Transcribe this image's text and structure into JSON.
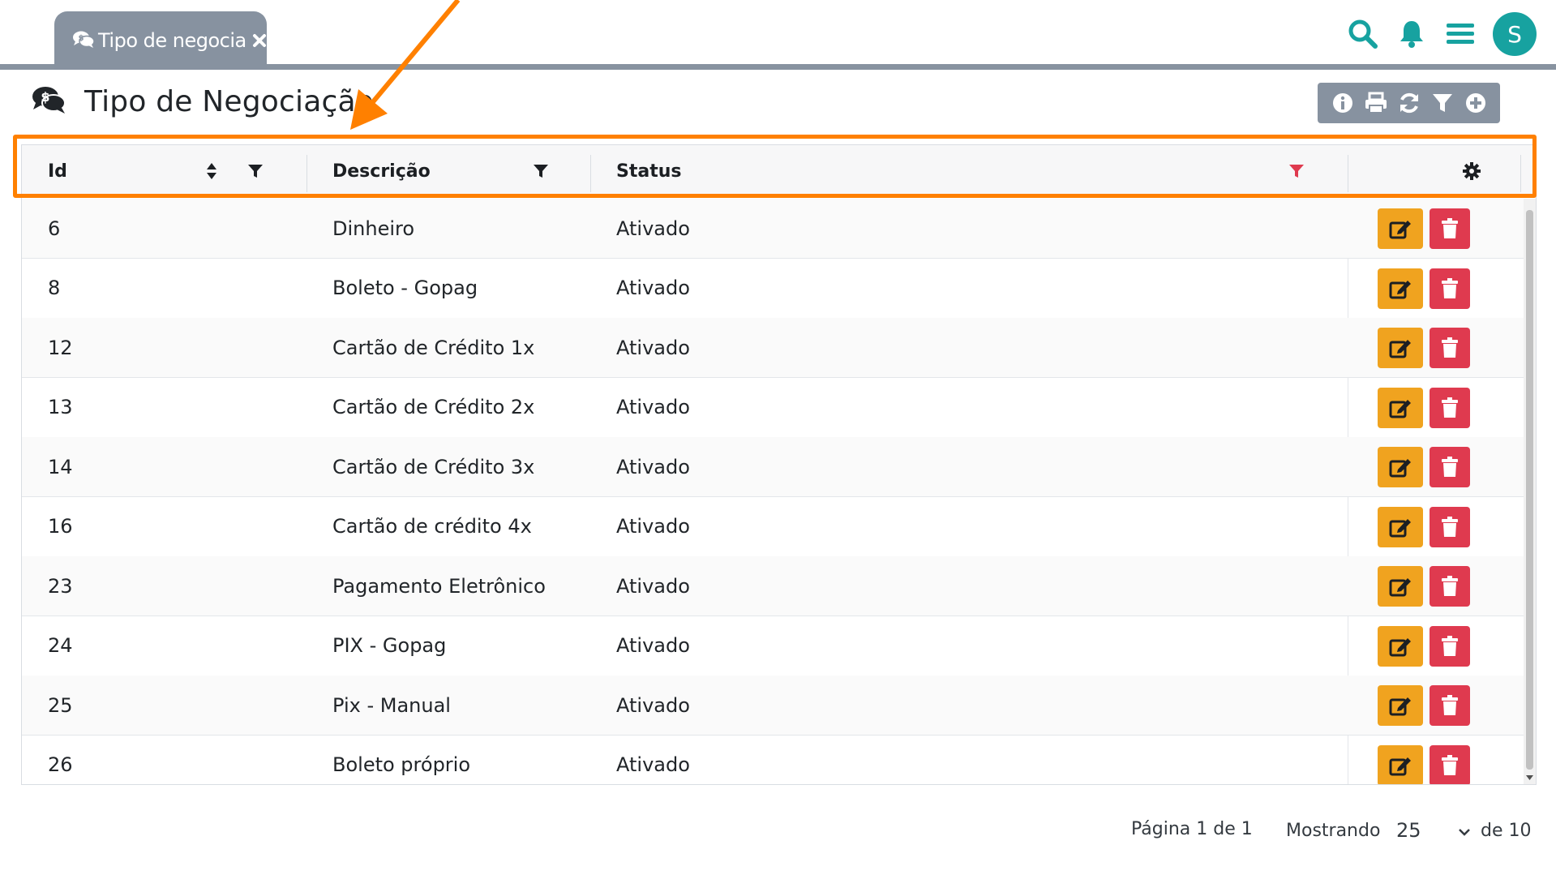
{
  "tab": {
    "label": "Tipo de negocia",
    "close": "close"
  },
  "topbar": {
    "avatar_letter": "S"
  },
  "page": {
    "title": "Tipo de Negociação"
  },
  "colors": {
    "accent": "#17a2a0",
    "gray": "#8792a0",
    "edit": "#f0a31f",
    "delete": "#df3a4f",
    "highlight": "#ff8000",
    "active_filter": "#df3a4f"
  },
  "table": {
    "columns": [
      {
        "label": "Id"
      },
      {
        "label": "Descrição"
      },
      {
        "label": "Status"
      }
    ],
    "rows": [
      {
        "id": "6",
        "descricao": "Dinheiro",
        "status": "Ativado"
      },
      {
        "id": "8",
        "descricao": "Boleto - Gopag",
        "status": "Ativado"
      },
      {
        "id": "12",
        "descricao": "Cartão de Crédito 1x",
        "status": "Ativado"
      },
      {
        "id": "13",
        "descricao": "Cartão de Crédito 2x",
        "status": "Ativado"
      },
      {
        "id": "14",
        "descricao": "Cartão de Crédito 3x",
        "status": "Ativado"
      },
      {
        "id": "16",
        "descricao": "Cartão de crédito 4x",
        "status": "Ativado"
      },
      {
        "id": "23",
        "descricao": "Pagamento Eletrônico",
        "status": "Ativado"
      },
      {
        "id": "24",
        "descricao": "PIX - Gopag",
        "status": "Ativado"
      },
      {
        "id": "25",
        "descricao": "Pix - Manual",
        "status": "Ativado"
      },
      {
        "id": "26",
        "descricao": "Boleto próprio",
        "status": "Ativado"
      }
    ]
  },
  "footer": {
    "pagination": "Página 1 de 1",
    "showing_label": "Mostrando",
    "page_size": "25",
    "of_total": "de 10"
  }
}
